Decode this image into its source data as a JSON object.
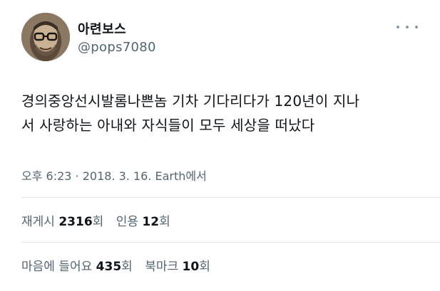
{
  "user": {
    "display_name": "아련보스",
    "handle": "@pops7080"
  },
  "tweet": {
    "lines": [
      "경의중앙선시발롬나쁜놈 기차 기다리다가 120년이 지나",
      "서 사랑하는 아내와 자식들이 모두 세상을 떠났다"
    ]
  },
  "meta": {
    "time": "오후 6:23",
    "separator": " · ",
    "date": "2018. 3. 16.",
    "source": "Earth",
    "source_suffix": "에서"
  },
  "stats": {
    "retweets_label": "재게시",
    "retweets_count": "2316",
    "retweets_unit": "회",
    "quotes_label": "인용",
    "quotes_count": "12",
    "quotes_unit": "회",
    "likes_label": "마음에 들어요",
    "likes_count": "435",
    "likes_unit": "회",
    "bookmarks_label": "북마크",
    "bookmarks_count": "10",
    "bookmarks_unit": "회"
  },
  "colors": {
    "text_primary": "#0f1419",
    "text_secondary": "#536471",
    "divider": "#e2e6ea"
  },
  "icons": {
    "more": "more-horizontal-icon",
    "avatar": "avatar-photo"
  }
}
